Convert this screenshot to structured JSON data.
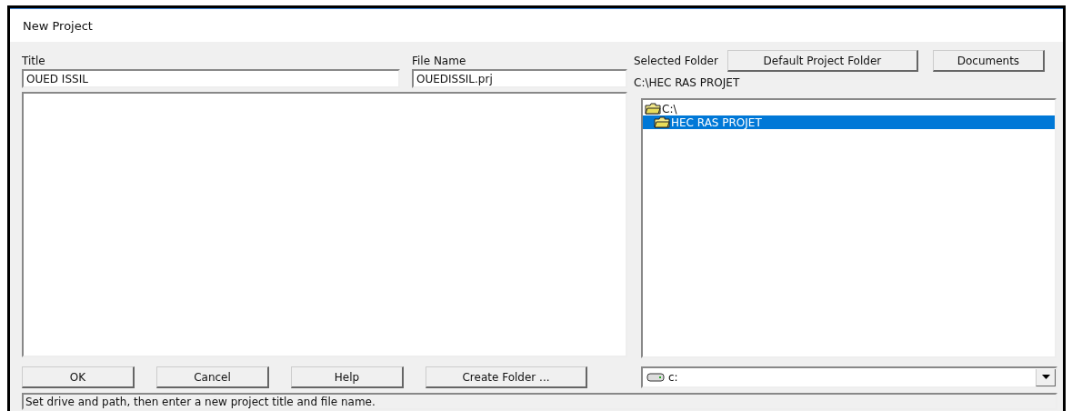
{
  "window": {
    "title": "New Project"
  },
  "title_field": {
    "label": "Title",
    "value": "OUED ISSIL"
  },
  "file_name_field": {
    "label": "File Name",
    "value": "OUEDISSIL.prj"
  },
  "selected_folder": {
    "label": "Selected Folder",
    "path": "C:\\HEC RAS PROJET"
  },
  "folder_buttons": [
    "Default Project Folder",
    "Documents"
  ],
  "folder_tree": [
    {
      "label": "C:\\",
      "selected": false,
      "children": [
        {
          "label": "HEC RAS PROJET",
          "selected": true
        }
      ]
    }
  ],
  "drive": {
    "value": "c:"
  },
  "buttons": [
    "OK",
    "Cancel",
    "Help",
    "Create Folder ..."
  ],
  "status_bar": "Set drive and path, then enter a new project title and file name."
}
